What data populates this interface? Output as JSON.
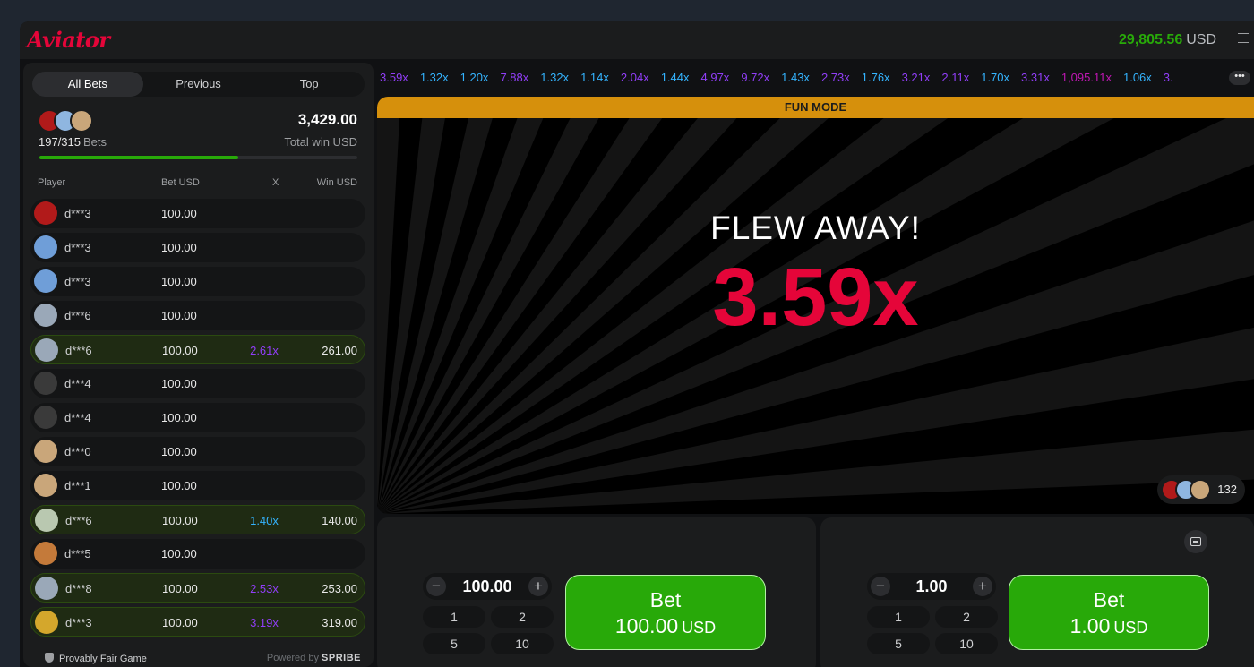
{
  "header": {
    "logo": "Aviator",
    "balance": "29,805.56",
    "currency": "USD"
  },
  "tabs": [
    "All Bets",
    "Previous",
    "Top"
  ],
  "summary": {
    "bets_count": "197/315",
    "bets_label": "Bets",
    "total_win": "3,429.00",
    "total_win_label": "Total win USD",
    "progress_fraction": 0.625
  },
  "columns": {
    "player": "Player",
    "bet": "Bet USD",
    "x": "X",
    "win": "Win USD"
  },
  "bets": [
    {
      "player": "d***3",
      "bet": "100.00",
      "x": "",
      "win": "",
      "avatar_color": "#b11a1a"
    },
    {
      "player": "d***3",
      "bet": "100.00",
      "x": "",
      "win": "",
      "avatar_color": "#6f9ed8"
    },
    {
      "player": "d***3",
      "bet": "100.00",
      "x": "",
      "win": "",
      "avatar_color": "#6f9ed8"
    },
    {
      "player": "d***6",
      "bet": "100.00",
      "x": "",
      "win": "",
      "avatar_color": "#9aa8b8"
    },
    {
      "player": "d***6",
      "bet": "100.00",
      "x": "2.61x",
      "win": "261.00",
      "avatar_color": "#9aa8b8"
    },
    {
      "player": "d***4",
      "bet": "100.00",
      "x": "",
      "win": "",
      "avatar_color": "#3a3a3a"
    },
    {
      "player": "d***4",
      "bet": "100.00",
      "x": "",
      "win": "",
      "avatar_color": "#3a3a3a"
    },
    {
      "player": "d***0",
      "bet": "100.00",
      "x": "",
      "win": "",
      "avatar_color": "#c9a67a"
    },
    {
      "player": "d***1",
      "bet": "100.00",
      "x": "",
      "win": "",
      "avatar_color": "#c9a67a"
    },
    {
      "player": "d***6",
      "bet": "100.00",
      "x": "1.40x",
      "win": "140.00",
      "avatar_color": "#b9c8b0"
    },
    {
      "player": "d***5",
      "bet": "100.00",
      "x": "",
      "win": "",
      "avatar_color": "#c47a3a"
    },
    {
      "player": "d***8",
      "bet": "100.00",
      "x": "2.53x",
      "win": "253.00",
      "avatar_color": "#9aa8b8"
    },
    {
      "player": "d***3",
      "bet": "100.00",
      "x": "3.19x",
      "win": "319.00",
      "avatar_color": "#d4a72c"
    }
  ],
  "footer": {
    "provably_fair": "Provably Fair Game",
    "powered_by": "Powered by",
    "brand": "SPRIBE"
  },
  "history": [
    {
      "value": "3.59x",
      "color": "#913ef8"
    },
    {
      "value": "1.32x",
      "color": "#34b4ff"
    },
    {
      "value": "1.20x",
      "color": "#34b4ff"
    },
    {
      "value": "7.88x",
      "color": "#913ef8"
    },
    {
      "value": "1.32x",
      "color": "#34b4ff"
    },
    {
      "value": "1.14x",
      "color": "#34b4ff"
    },
    {
      "value": "2.04x",
      "color": "#913ef8"
    },
    {
      "value": "1.44x",
      "color": "#34b4ff"
    },
    {
      "value": "4.97x",
      "color": "#913ef8"
    },
    {
      "value": "9.72x",
      "color": "#913ef8"
    },
    {
      "value": "1.43x",
      "color": "#34b4ff"
    },
    {
      "value": "2.73x",
      "color": "#913ef8"
    },
    {
      "value": "1.76x",
      "color": "#34b4ff"
    },
    {
      "value": "3.21x",
      "color": "#913ef8"
    },
    {
      "value": "2.11x",
      "color": "#913ef8"
    },
    {
      "value": "1.70x",
      "color": "#34b4ff"
    },
    {
      "value": "3.31x",
      "color": "#913ef8"
    },
    {
      "value": "1,095.11x",
      "color": "#c017b4"
    },
    {
      "value": "1.06x",
      "color": "#34b4ff"
    },
    {
      "value": "3.",
      "color": "#913ef8"
    }
  ],
  "game": {
    "fun_mode": "FUN MODE",
    "status": "FLEW AWAY!",
    "multiplier": "3.59x",
    "players_count": "132"
  },
  "panels": [
    {
      "amount": "100.00",
      "quick": [
        "1",
        "2",
        "5",
        "10"
      ],
      "bet_label": "Bet",
      "bet_amount": "100.00",
      "bet_currency": "USD"
    },
    {
      "amount": "1.00",
      "quick": [
        "1",
        "2",
        "5",
        "10"
      ],
      "bet_label": "Bet",
      "bet_amount": "1.00",
      "bet_currency": "USD"
    }
  ],
  "colors": {
    "brand_red": "#e50539",
    "balance_green": "#28a909",
    "fun_mode": "#d6900c",
    "bet_button": "#28a909"
  }
}
